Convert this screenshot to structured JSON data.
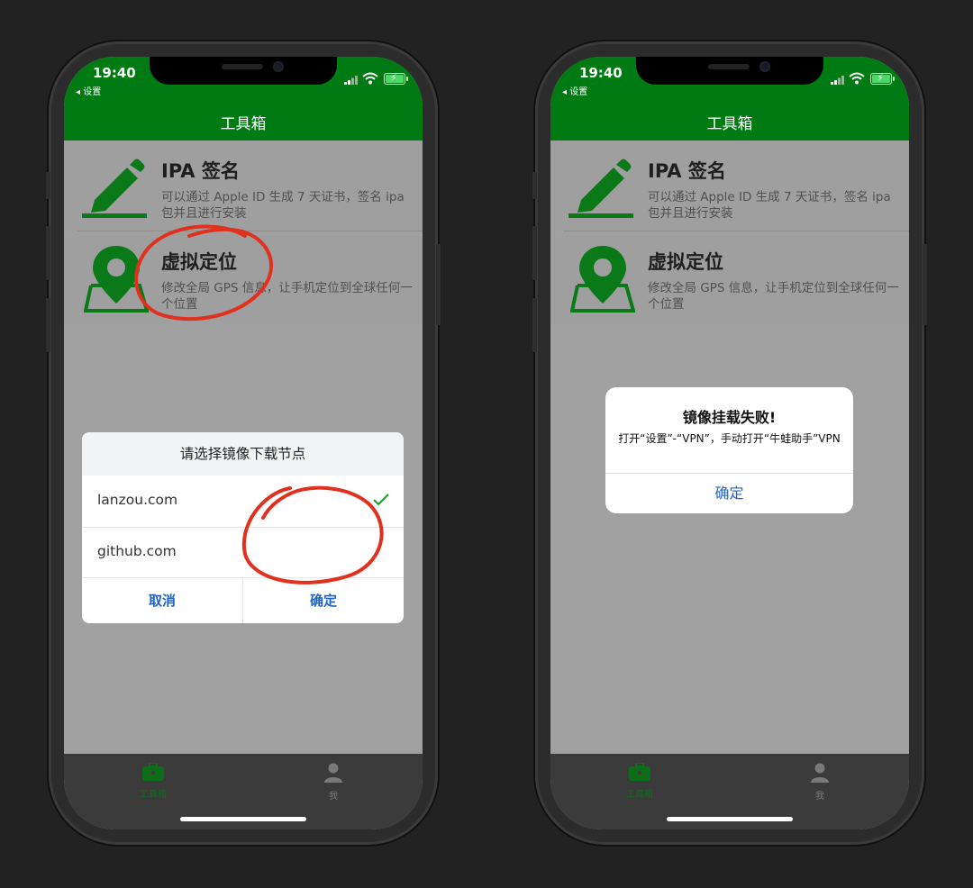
{
  "phones": {
    "left": {
      "status": {
        "time": "19:40",
        "back": "◂ 设置"
      },
      "nav": {
        "title": "工具箱"
      },
      "items": [
        {
          "title": "IPA 签名",
          "desc": "可以通过 Apple ID 生成 7 天证书，签名 ipa 包并且进行安装"
        },
        {
          "title": "虚拟定位",
          "desc": "修改全局 GPS 信息，让手机定位到全球任何一个位置"
        }
      ],
      "sheet": {
        "title": "请选择镜像下载节点",
        "options": [
          "lanzou.com",
          "github.com"
        ],
        "selected": "lanzou.com",
        "cancel": "取消",
        "confirm": "确定"
      },
      "tabs": [
        {
          "label": "工具箱",
          "icon": "toolbox-icon"
        },
        {
          "label": "我",
          "icon": "person-icon"
        }
      ]
    },
    "right": {
      "status": {
        "time": "19:40",
        "back": "◂ 设置"
      },
      "nav": {
        "title": "工具箱"
      },
      "items": [
        {
          "title": "IPA 签名",
          "desc": "可以通过 Apple ID 生成 7 天证书，签名 ipa 包并且进行安装"
        },
        {
          "title": "虚拟定位",
          "desc": "修改全局 GPS 信息，让手机定位到全球任何一个位置"
        }
      ],
      "alert": {
        "title": "镜像挂载失败!",
        "message": "打开“设置”-“VPN”，手动打开“牛蛙助手”VPN",
        "button": "确定"
      },
      "tabs": [
        {
          "label": "工具箱",
          "icon": "toolbox-icon"
        },
        {
          "label": "我",
          "icon": "person-icon"
        }
      ]
    }
  },
  "colors": {
    "navbar": "#007a12",
    "accent": "#1e63c4",
    "annotation": "#e0301e",
    "icon": "#0a7a18"
  }
}
